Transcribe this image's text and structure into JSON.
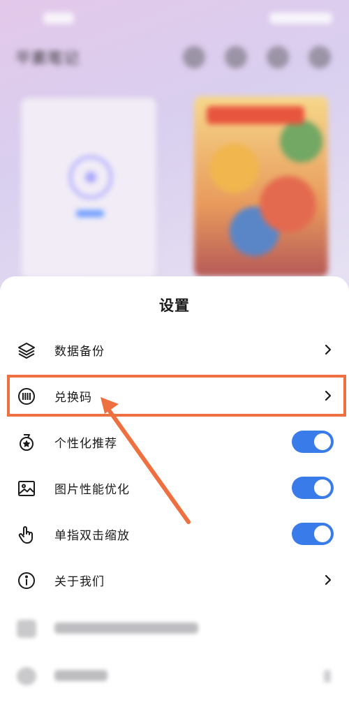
{
  "colors": {
    "accent_blue": "#3a7bea",
    "annotation_orange": "#ee6f3f",
    "text": "#1a1a1a"
  },
  "background_app": {
    "title": "平素笔记"
  },
  "settings_sheet": {
    "title": "设置",
    "items": [
      {
        "label": "数据备份",
        "icon": "layers-icon",
        "control": "chevron"
      },
      {
        "label": "兑换码",
        "icon": "barcode-icon",
        "control": "chevron"
      },
      {
        "label": "个性化推荐",
        "icon": "badge-star-icon",
        "control": "toggle",
        "toggle_on": true
      },
      {
        "label": "图片性能优化",
        "icon": "image-icon",
        "control": "toggle",
        "toggle_on": true
      },
      {
        "label": "单指双击缩放",
        "icon": "hand-pointer-icon",
        "control": "toggle",
        "toggle_on": true
      },
      {
        "label": "关于我们",
        "icon": "info-icon",
        "control": "chevron"
      }
    ]
  }
}
